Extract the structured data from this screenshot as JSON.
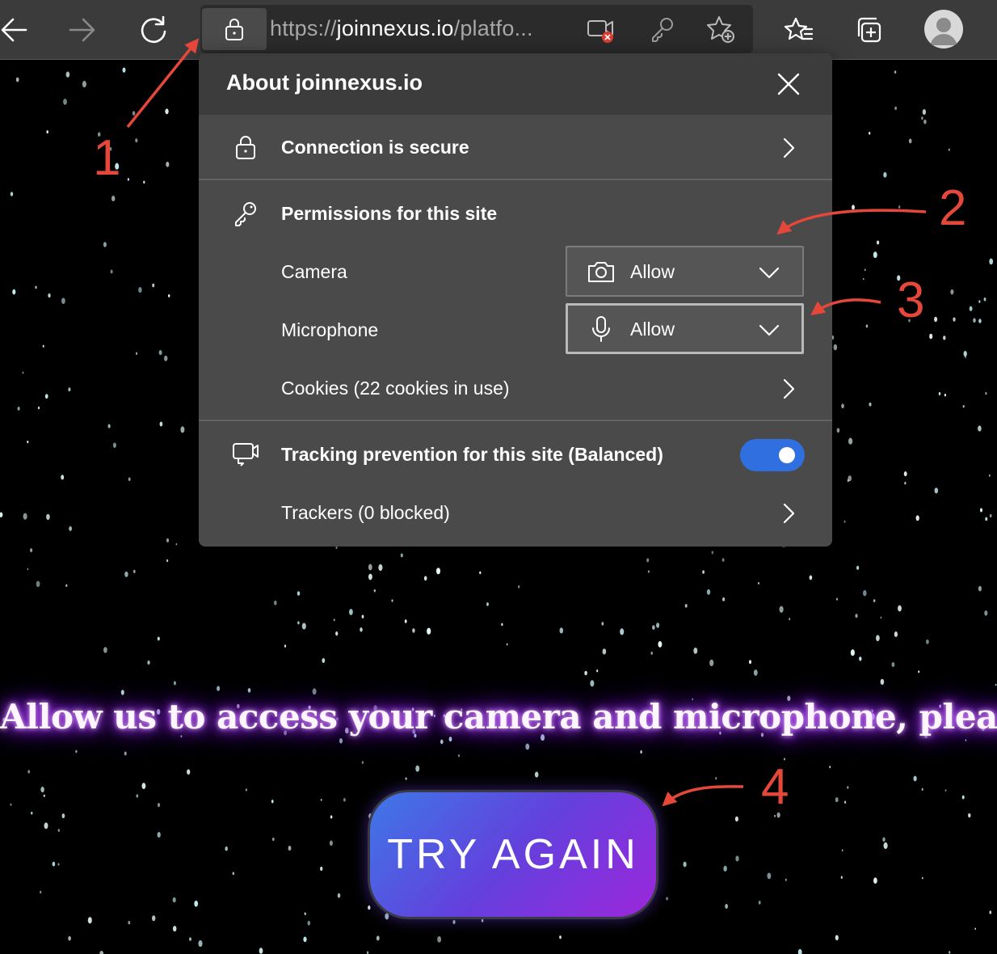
{
  "browser": {
    "url_scheme": "https://",
    "url_host": "joinnexus.io",
    "url_path": "/platfo..."
  },
  "popup": {
    "title": "About joinnexus.io",
    "connection": {
      "label": "Connection is secure"
    },
    "permissions": {
      "heading": "Permissions for this site",
      "camera": {
        "label": "Camera",
        "value": "Allow"
      },
      "microphone": {
        "label": "Microphone",
        "value": "Allow"
      },
      "cookies": {
        "label": "Cookies (22 cookies in use)"
      }
    },
    "tracking": {
      "label": "Tracking prevention for this site (Balanced)",
      "enabled": true,
      "trackers": "Trackers (0 blocked)"
    }
  },
  "page": {
    "headline": "Allow us to access your camera and microphone, please",
    "button_label": "TRY AGAIN"
  },
  "annotations": {
    "labels": [
      "1",
      "2",
      "3",
      "4"
    ],
    "color": "#e5473a"
  },
  "colors": {
    "toggle_on": "#2f6fe0",
    "button_gradient": [
      "#3e78e8",
      "#9c27db"
    ],
    "headline_glow": "#b447ff"
  }
}
